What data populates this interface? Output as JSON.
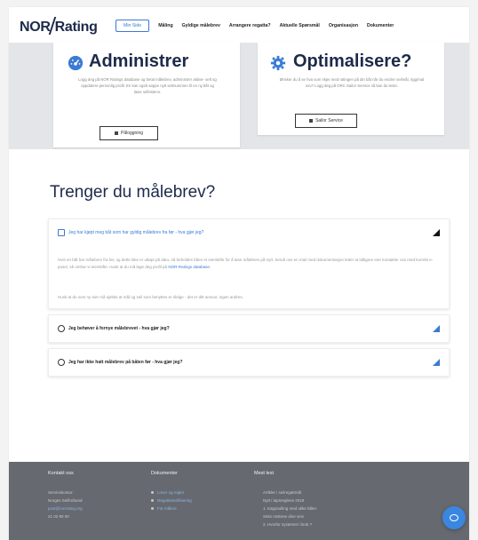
{
  "header": {
    "logo_left": "NOR",
    "logo_right": "Rating",
    "nav": [
      {
        "label": "Min Side",
        "active": true
      },
      {
        "label": "Måling"
      },
      {
        "label": "Gyldige målebrev"
      },
      {
        "label": "Arrangere regatta?"
      },
      {
        "label": "Aktuelle Spørsmål"
      },
      {
        "label": "Organisasjon"
      },
      {
        "label": "Dokumenter"
      }
    ]
  },
  "hero": {
    "card1": {
      "title": "Administrer",
      "icon": "gauge-icon",
      "text": "Logg deg på NOR Ratings database og betal målebrev, administrer aktive- selt og oppdatere personlig profil. En kan også søppe nytt selmummen til en ny båt og laise selbistens.",
      "button": "Påloggning"
    },
    "card2": {
      "title": "Optimalisere?",
      "icon": "gear-icon",
      "text": "Ønsker du å se hva som skjer med ratingen på din båt når du endrer seilmål, rigg/mal osv? Logg deg på ORC Sailor Service så kan du teste.",
      "button": "Sailor Service"
    }
  },
  "main": {
    "title": "Trenger du målebrev?",
    "faqs": [
      {
        "question": "Jeg har kjøpt meg båt som har gyldig målebrev fra før - hva gjør jeg?",
        "answer1": "Hvis en båt har målebrev fra før, og dette ikke er utløpt på dato, så beholdes båen et eierskifte for å løse målebrev på nytt. Sendt oss en mail med dokumentasjon letter at tidligere eier kontakter oss med korrekt e-posel, så omhar vi eierskifte. Husk at du må lage deg profil på",
        "answer1_link": "NOR-Ratings database.",
        "answer2": "Husk at du som ny eier må sjekke at mål og seil som benyttes er riktige - det er ditt ansvar, ingen andres."
      },
      {
        "question": "Jeg behøver å fornye målebrevet - hva gjør jeg?"
      },
      {
        "question": "Jeg har ikke hatt målebrev på båten før - hva gjør jeg?"
      }
    ]
  },
  "footer": {
    "col1": {
      "head": "Kontakt oss",
      "lines": [
        "Servicekontor:",
        "Norges Seilforbund",
        "post@norrating.org",
        "21 02 90 00"
      ]
    },
    "col2": {
      "head": "Dokumenter",
      "lines": [
        "Lover og regler",
        "Regattasertifisering",
        "For målere"
      ]
    },
    "col3": {
      "head": "Mest lest",
      "lines": [
        "Artikler i seilregattmål",
        "Nytt i løpsreglene 2019",
        "1. Kappsulling med ulike båter",
        "Seks mistene dine seiv",
        "2. Hvorfor systemet i bruk ?"
      ]
    }
  },
  "colors": {
    "accent": "#3a7bd5",
    "navy": "#1d2a4a",
    "footer": "#666a70"
  }
}
